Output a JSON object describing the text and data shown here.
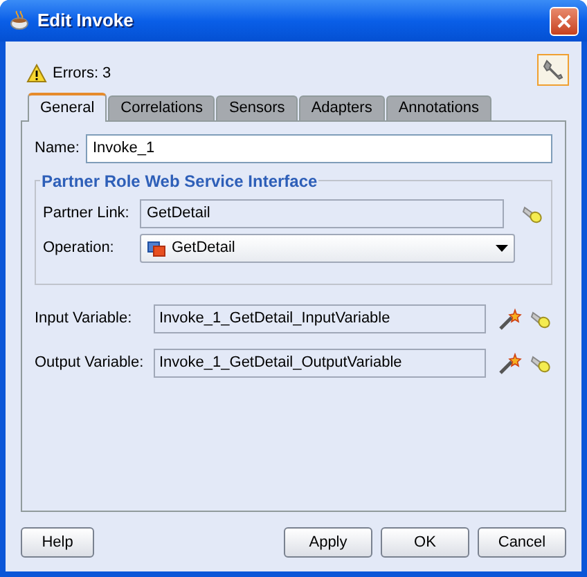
{
  "window": {
    "title": "Edit Invoke"
  },
  "errors": {
    "text": "Errors: 3"
  },
  "tabs": [
    {
      "label": "General",
      "selected": true
    },
    {
      "label": "Correlations",
      "selected": false
    },
    {
      "label": "Sensors",
      "selected": false
    },
    {
      "label": "Adapters",
      "selected": false
    },
    {
      "label": "Annotations",
      "selected": false
    }
  ],
  "name_field": {
    "label": "Name:",
    "value": "Invoke_1"
  },
  "group": {
    "legend": "Partner Role Web Service Interface",
    "rows": [
      {
        "kind": "text",
        "label": "Partner Link:",
        "value": "GetDetail"
      },
      {
        "kind": "dropdown",
        "label": "Operation:",
        "value": "GetDetail"
      }
    ]
  },
  "variables": [
    {
      "label": "Input Variable:",
      "value": "Invoke_1_GetDetail_InputVariable"
    },
    {
      "label": "Output Variable:",
      "value": "Invoke_1_GetDetail_OutputVariable"
    }
  ],
  "buttons": [
    {
      "label": "Help",
      "kind": "left"
    },
    {
      "label": "Apply",
      "kind": "right"
    },
    {
      "label": "OK",
      "kind": "right"
    },
    {
      "label": "Cancel",
      "kind": "right"
    }
  ]
}
